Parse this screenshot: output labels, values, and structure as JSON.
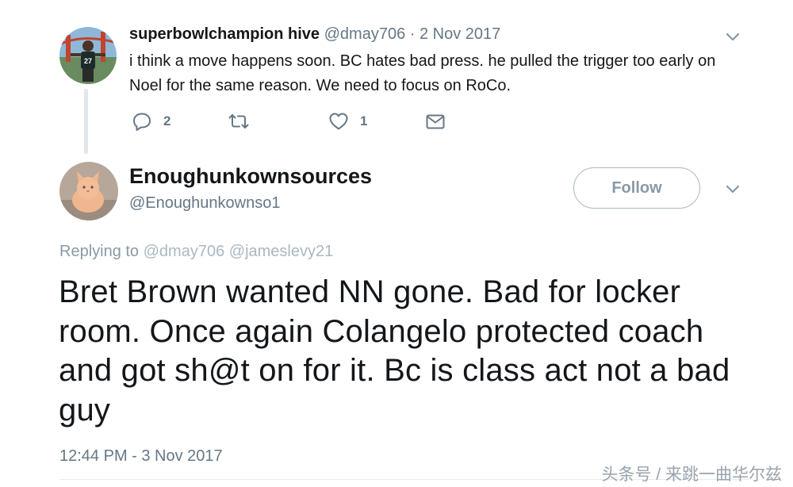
{
  "reply_tweet": {
    "name": "superbowlchampion hive",
    "handle": "@dmay706",
    "separator": "·",
    "date": "2 Nov 2017",
    "text": "i think a move happens soon. BC hates bad press. he pulled the trigger too early on Noel for the same reason. We need to focus on RoCo.",
    "reply_count": "2",
    "retweet_count": "",
    "like_count": "1"
  },
  "main_tweet": {
    "name": "Enoughunkownsources",
    "handle": "@Enoughunkownso1",
    "follow_label": "Follow",
    "replying_label": "Replying to",
    "replying_mentions": "@dmay706 @jameslevy21",
    "text": "Bret Brown wanted NN gone. Bad for locker room. Once again Colangelo protected coach and got sh@t on for it. Bc is class act not a bad guy",
    "timestamp": "12:44 PM - 3 Nov 2017"
  },
  "watermark": "头条号 / 来跳一曲华尔兹",
  "icons": [
    "reply-icon",
    "retweet-icon",
    "heart-icon",
    "message-icon",
    "chevron-down-icon"
  ],
  "colors": {
    "text": "#14171a",
    "secondary": "#657786",
    "muted": "#8899a6",
    "border": "#aab8c2"
  }
}
